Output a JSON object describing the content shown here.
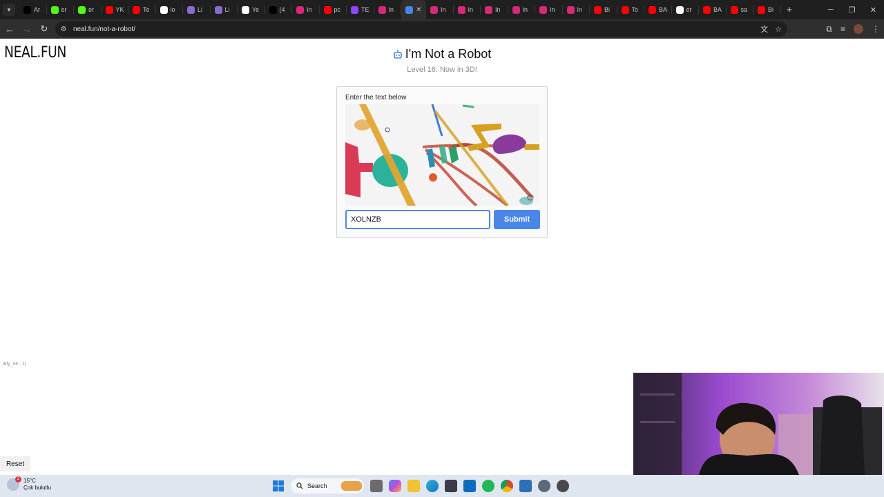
{
  "browser": {
    "tabs": [
      {
        "favicon": "x-icon",
        "title": "Ar",
        "color": "#000000"
      },
      {
        "favicon": "kick-icon",
        "title": "er",
        "color": "#53fc18"
      },
      {
        "favicon": "kick-icon",
        "title": "er",
        "color": "#53fc18"
      },
      {
        "favicon": "youtube-icon",
        "title": "YK",
        "color": "#ff0000"
      },
      {
        "favicon": "youtube-icon",
        "title": "Te",
        "color": "#ff0000"
      },
      {
        "favicon": "google-icon",
        "title": "lo",
        "color": "#ffffff"
      },
      {
        "favicon": "feather-icon",
        "title": "Li",
        "color": "#8a6bd1"
      },
      {
        "favicon": "feather-icon",
        "title": "Li",
        "color": "#8a6bd1"
      },
      {
        "favicon": "github-icon",
        "title": "Ye",
        "color": "#ffffff"
      },
      {
        "favicon": "x-icon",
        "title": "(4",
        "color": "#000000"
      },
      {
        "favicon": "instagram-icon",
        "title": "In",
        "color": "#d62976"
      },
      {
        "favicon": "youtube-icon",
        "title": "pc",
        "color": "#ff0000"
      },
      {
        "favicon": "twitch-icon",
        "title": "TE",
        "color": "#9146ff"
      },
      {
        "favicon": "instagram-icon",
        "title": "In",
        "color": "#d62976"
      },
      {
        "favicon": "robot-icon",
        "title": "",
        "color": "#4a86e8",
        "active": true
      },
      {
        "favicon": "instagram-icon",
        "title": "In",
        "color": "#d62976"
      },
      {
        "favicon": "instagram-icon",
        "title": "In",
        "color": "#d62976"
      },
      {
        "favicon": "instagram-icon",
        "title": "In",
        "color": "#d62976"
      },
      {
        "favicon": "instagram-icon",
        "title": "In",
        "color": "#d62976"
      },
      {
        "favicon": "instagram-icon",
        "title": "In",
        "color": "#d62976"
      },
      {
        "favicon": "instagram-icon",
        "title": "In",
        "color": "#d62976"
      },
      {
        "favicon": "youtube-icon",
        "title": "Bi",
        "color": "#ff0000"
      },
      {
        "favicon": "youtube-icon",
        "title": "To",
        "color": "#ff0000"
      },
      {
        "favicon": "youtube-icon",
        "title": "BA",
        "color": "#ff0000"
      },
      {
        "favicon": "google-icon",
        "title": "er",
        "color": "#ffffff"
      },
      {
        "favicon": "youtube-icon",
        "title": "BA",
        "color": "#ff0000"
      },
      {
        "favicon": "youtube-icon",
        "title": "sa",
        "color": "#ff0000"
      },
      {
        "favicon": "youtube-icon",
        "title": "Bi",
        "color": "#ff0000"
      }
    ],
    "url": "neal.fun/not-a-robot/"
  },
  "page": {
    "logo": "NEAL.FUN",
    "title": "I'm Not a Robot",
    "subtitle": "Level 16: Now in 3D!",
    "captcha": {
      "label": "Enter the text below",
      "input_value": "XOLNZB",
      "submit_label": "Submit"
    },
    "tiny_text": "ally_ne : 1)",
    "reset_label": "Reset"
  },
  "taskbar": {
    "weather_temp": "15°C",
    "weather_desc": "Çok bulutlu",
    "weather_badge": "2",
    "search_label": "Search"
  },
  "colors": {
    "accent": "#4a86e8",
    "chrome_dark": "#1f1f1f",
    "toolbar": "#2f2f2f"
  }
}
